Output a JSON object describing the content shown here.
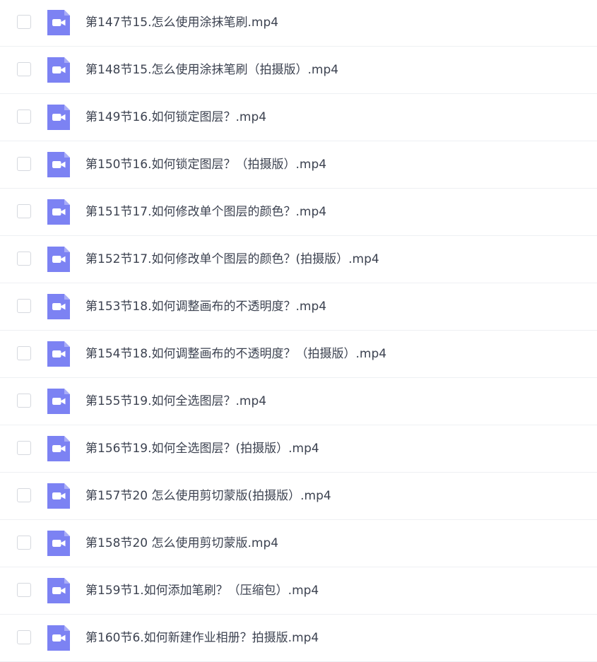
{
  "file_icon": {
    "name": "video-file-icon",
    "color": "#7c82f3"
  },
  "files": [
    {
      "name": "第147节15.怎么使用涂抹笔刷.mp4",
      "checked": false
    },
    {
      "name": "第148节15.怎么使用涂抹笔刷（拍摄版）.mp4",
      "checked": false
    },
    {
      "name": "第149节16.如何锁定图层？.mp4",
      "checked": false
    },
    {
      "name": "第150节16.如何锁定图层？（拍摄版）.mp4",
      "checked": false
    },
    {
      "name": "第151节17.如何修改单个图层的颜色？.mp4",
      "checked": false
    },
    {
      "name": "第152节17.如何修改单个图层的颜色？(拍摄版）.mp4",
      "checked": false
    },
    {
      "name": "第153节18.如何调整画布的不透明度？.mp4",
      "checked": false
    },
    {
      "name": "第154节18.如何调整画布的不透明度？（拍摄版）.mp4",
      "checked": false
    },
    {
      "name": "第155节19.如何全选图层？.mp4",
      "checked": false
    },
    {
      "name": "第156节19.如何全选图层？(拍摄版）.mp4",
      "checked": false
    },
    {
      "name": "第157节20 怎么使用剪切蒙版(拍摄版）.mp4",
      "checked": false
    },
    {
      "name": "第158节20 怎么使用剪切蒙版.mp4",
      "checked": false
    },
    {
      "name": "第159节1.如何添加笔刷？（压缩包）.mp4",
      "checked": false
    },
    {
      "name": "第160节6.如何新建作业相册？拍摄版.mp4",
      "checked": false
    }
  ]
}
